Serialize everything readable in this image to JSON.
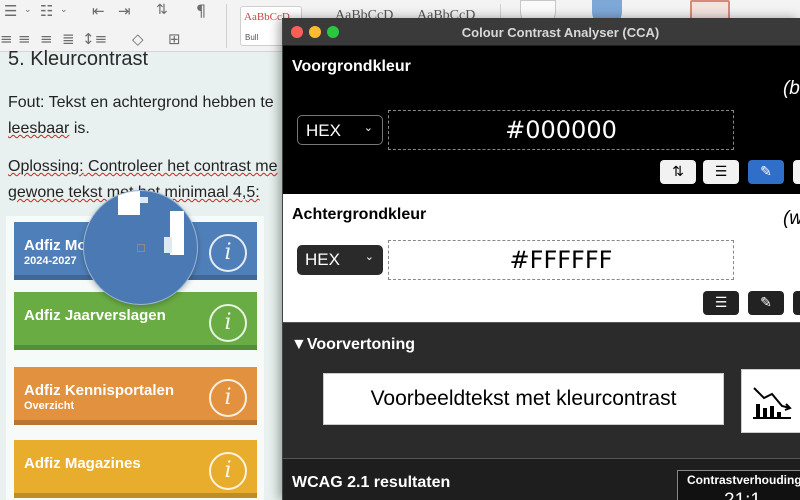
{
  "document": {
    "heading": "5. Kleurcontrast",
    "paragraph1": {
      "line1": "Fout: Tekst en achtergrond hebben te",
      "line2_prefix": "leesbaar",
      "line2_suffix": " is."
    },
    "paragraph2": {
      "line1_prefix": "Oplossing:",
      "line1_mid": " Controleer het contrast me",
      "line2_prefix": "gewone tekst m",
      "line2_suffix": "et het minimaal 4,5:"
    },
    "ribbon": {
      "style1": "AaBbCcD",
      "style1_label": "Bull",
      "style2": "AaBbCcDd",
      "style3": "AaBbCcDd"
    },
    "tiles": [
      {
        "title": "Adfiz Mo",
        "subtitle": "2024-2027",
        "color": "#4f7fb8"
      },
      {
        "title": "Adfiz Jaarverslagen",
        "subtitle": "",
        "color": "#6aac44"
      },
      {
        "title": "Adfiz Kennisportalen",
        "subtitle": "Overzicht",
        "color": "#e2923e"
      },
      {
        "title": "Adfiz Magazines",
        "subtitle": "",
        "color": "#e8ad2c"
      }
    ]
  },
  "cca": {
    "window_title": "Colour Contrast Analyser (CCA)",
    "foreground": {
      "title": "Voorgrondkleur",
      "color_name": "(black)",
      "format": "HEX",
      "value": "#000000"
    },
    "background": {
      "title": "Achtergrondkleur",
      "color_name": "(white)",
      "format": "HEX",
      "value": "#FFFFFF"
    },
    "preview": {
      "title": "▼Voorvertoning",
      "sample_text": "Voorbeeldtekst met kleurcontrast"
    },
    "results": {
      "title": "WCAG 2.1 resultaten",
      "ratio_label": "Contrastverhouding",
      "ratio_value": "21:1"
    },
    "colors": {
      "accent": "#2f6fc9",
      "close": "#ff5f57",
      "minimize": "#febc2e",
      "zoom": "#28c840"
    }
  }
}
